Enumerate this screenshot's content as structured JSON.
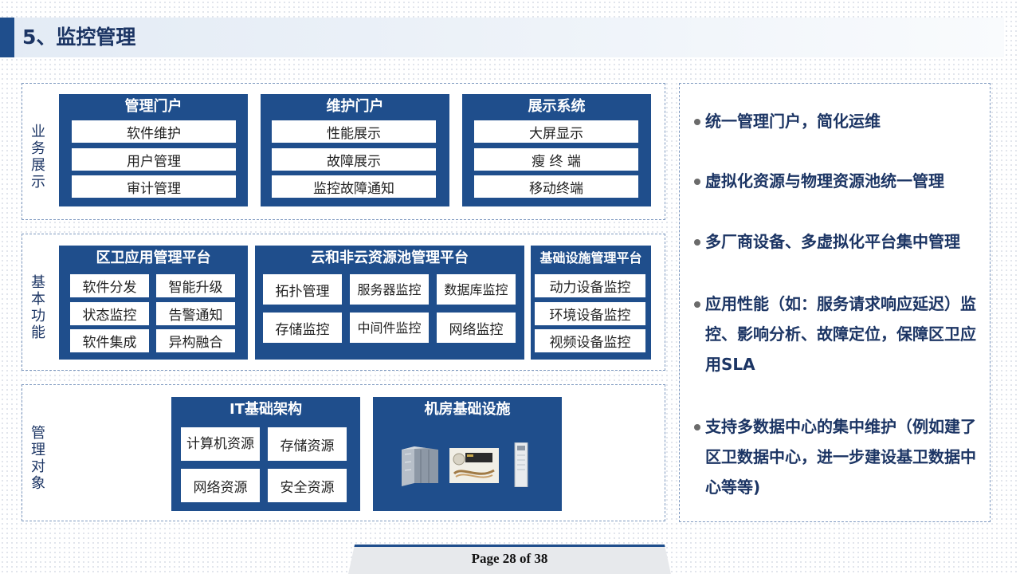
{
  "page": {
    "title": "5、监控管理",
    "footer": "Page 28 of 38"
  },
  "sections": {
    "business": {
      "label": "业务展示",
      "boxes": [
        {
          "title": "管理门户",
          "items": [
            "软件维护",
            "用户管理",
            "审计管理"
          ]
        },
        {
          "title": "维护门户",
          "items": [
            "性能展示",
            "故障展示",
            "监控故障通知"
          ]
        },
        {
          "title": "展示系统",
          "items": [
            "大屏显示",
            "瘦 终 端",
            "移动终端"
          ]
        }
      ]
    },
    "functions": {
      "label": "基本功能",
      "boxes": [
        {
          "title": "区卫应用管理平台",
          "items": [
            "软件分发",
            "智能升级",
            "状态监控",
            "告警通知",
            "软件集成",
            "异构融合"
          ]
        },
        {
          "title": "云和非云资源池管理平台",
          "items": [
            "拓扑管理",
            "服务器监控",
            "数据库监控",
            "存储监控",
            "中间件监控",
            "网络监控"
          ]
        },
        {
          "title": "基础设施管理平台",
          "items": [
            "动力设备监控",
            "环境设备监控",
            "视频设备监控"
          ]
        }
      ]
    },
    "objects": {
      "label": "管理对象",
      "boxes": [
        {
          "title": "IT基础架构",
          "items": [
            "计算机资源",
            "存储资源",
            "网络资源",
            "安全资源"
          ]
        },
        {
          "title": "机房基础设施",
          "image_icons": [
            "server-rack-icon",
            "monitoring-device-icon",
            "tower-unit-icon"
          ]
        }
      ]
    }
  },
  "bullets": [
    "统一管理门户，简化运维",
    "虚拟化资源与物理资源池统一管理",
    "多厂商设备、多虚拟化平台集中管理",
    "应用性能（如：服务请求响应延迟）监控、影响分析、故障定位，保障区卫应用SLA",
    "支持多数据中心的集中维护（例如建了区卫数据中心，进一步建设基卫数据中心等等)"
  ],
  "colors": {
    "navy": "#1f4e8c",
    "title_text": "#1c3564",
    "dash": "#7d98bf"
  }
}
